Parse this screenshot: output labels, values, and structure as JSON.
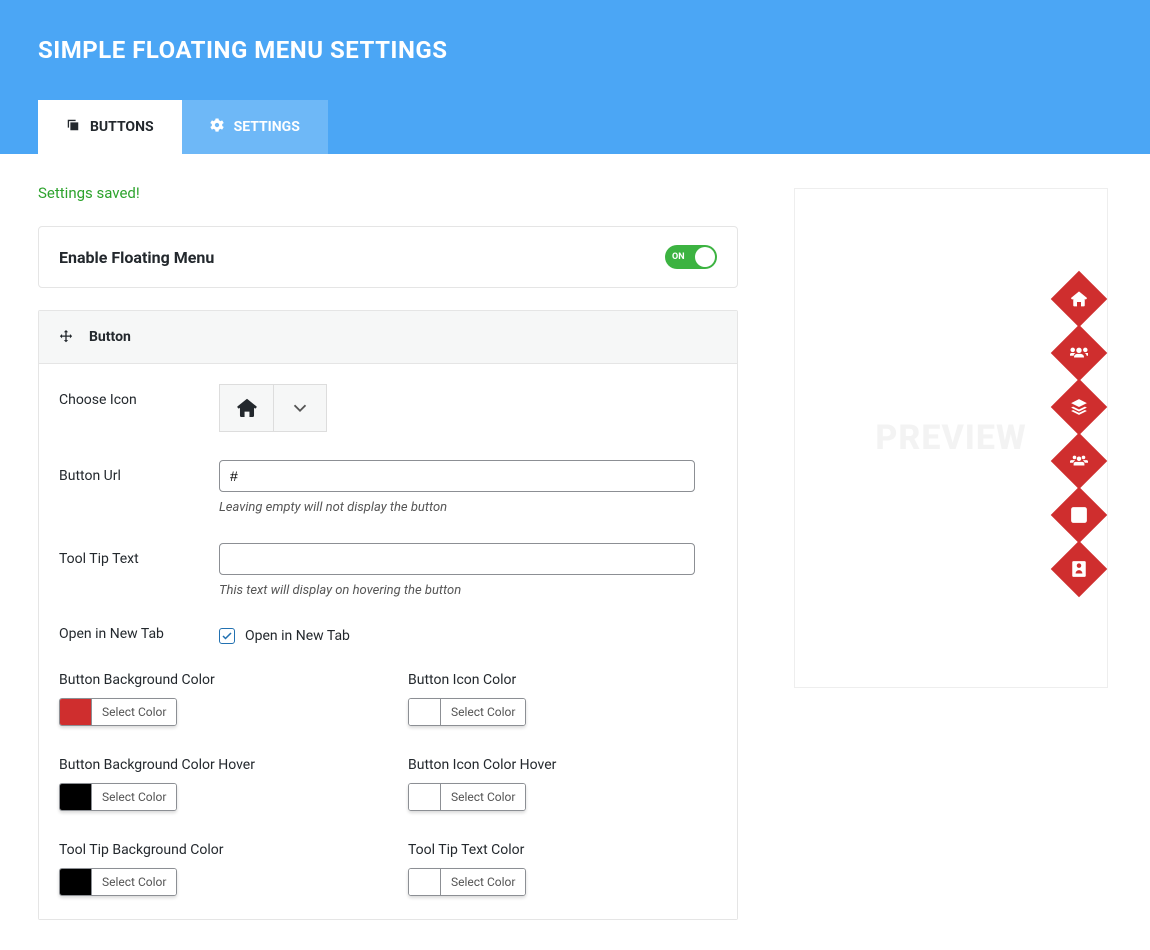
{
  "header": {
    "title": "SIMPLE FLOATING MENU SETTINGS",
    "tabs": [
      {
        "label": "BUTTONS",
        "icon": "clone-icon",
        "active": true
      },
      {
        "label": "SETTINGS",
        "icon": "gear-icon",
        "active": false
      }
    ]
  },
  "notice": "Settings saved!",
  "enable_card": {
    "title": "Enable Floating Menu",
    "toggle_state": "ON"
  },
  "panel": {
    "title": "Button",
    "fields": {
      "choose_icon_label": "Choose Icon",
      "selected_icon": "home-icon",
      "button_url_label": "Button Url",
      "button_url_value": "#",
      "button_url_hint": "Leaving empty will not display the button",
      "tooltip_label": "Tool Tip Text",
      "tooltip_value": "",
      "tooltip_hint": "This text will display on hovering the button",
      "open_new_tab_label": "Open in New Tab",
      "open_new_tab_checkbox_label": "Open in New Tab",
      "open_new_tab_checked": true
    },
    "colors": {
      "select_label": "Select Color",
      "items": [
        {
          "label": "Button Background Color",
          "value": "#cf2e2e"
        },
        {
          "label": "Button Icon Color",
          "value": "#ffffff"
        },
        {
          "label": "Button Background Color Hover",
          "value": "#000000"
        },
        {
          "label": "Button Icon Color Hover",
          "value": "#ffffff"
        },
        {
          "label": "Tool Tip Background Color",
          "value": "#000000"
        },
        {
          "label": "Tool Tip Text Color",
          "value": "#ffffff"
        }
      ]
    }
  },
  "preview": {
    "watermark": "PREVIEW",
    "buttons": [
      {
        "icon": "home-icon"
      },
      {
        "icon": "users-gear-icon"
      },
      {
        "icon": "layers-icon"
      },
      {
        "icon": "people-group-icon"
      },
      {
        "icon": "blog-icon"
      },
      {
        "icon": "badge-icon"
      }
    ]
  }
}
